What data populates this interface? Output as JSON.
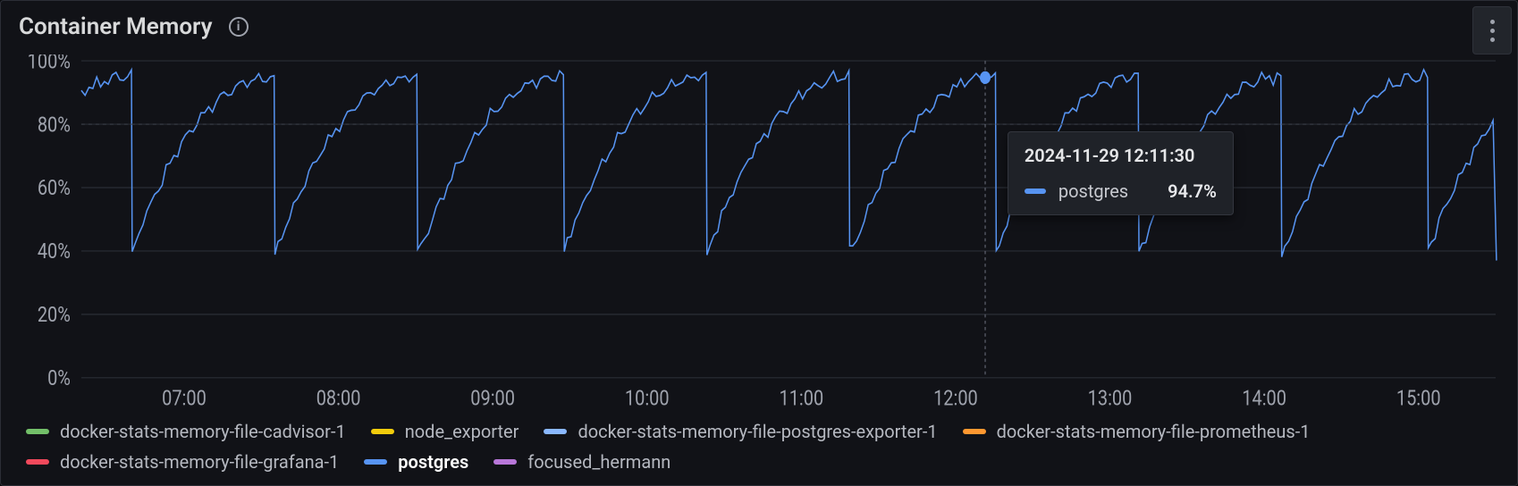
{
  "panel": {
    "title": "Container Memory"
  },
  "tooltip": {
    "timestamp": "2024-11-29 12:11:30",
    "series_name": "postgres",
    "value": "94.7%",
    "color": "#5794f2"
  },
  "legend": [
    {
      "name": "docker-stats-memory-file-cadvisor-1",
      "color": "#73bf69",
      "active": false
    },
    {
      "name": "node_exporter",
      "color": "#f2cc0c",
      "active": false
    },
    {
      "name": "docker-stats-memory-file-postgres-exporter-1",
      "color": "#8ab8ff",
      "active": false
    },
    {
      "name": "docker-stats-memory-file-prometheus-1",
      "color": "#ff9830",
      "active": false
    },
    {
      "name": "docker-stats-memory-file-grafana-1",
      "color": "#f2495c",
      "active": false
    },
    {
      "name": "postgres",
      "color": "#5794f2",
      "active": true
    },
    {
      "name": "focused_hermann",
      "color": "#b877d9",
      "active": false
    }
  ],
  "chart_data": {
    "type": "line",
    "title": "Container Memory",
    "xlabel": "",
    "ylabel": "",
    "ylim": [
      0,
      100
    ],
    "y_ticks": [
      0,
      20,
      40,
      60,
      80,
      100
    ],
    "y_tick_labels": [
      "0%",
      "20%",
      "40%",
      "60%",
      "80%",
      "100%"
    ],
    "x_ticks": [
      "07:00",
      "08:00",
      "09:00",
      "10:00",
      "11:00",
      "12:00",
      "13:00",
      "14:00",
      "15:00"
    ],
    "x_range_minutes": [
      380,
      930
    ],
    "hover": {
      "x_min": 731.5,
      "y": 94.7
    },
    "series": [
      {
        "name": "postgres",
        "color": "#5794f2",
        "sawtooth": {
          "start_min": 380,
          "end_min": 930,
          "period_min": 56,
          "low": 40,
          "high": 95,
          "initial_phase": 0.65
        }
      }
    ]
  }
}
